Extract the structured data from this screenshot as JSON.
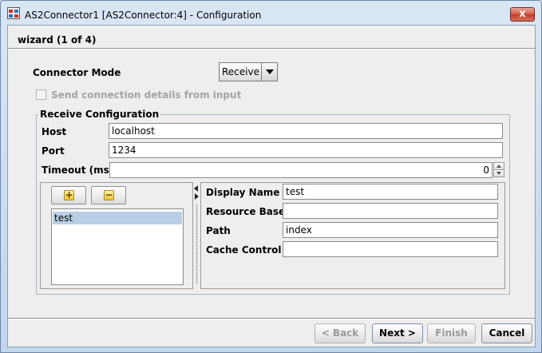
{
  "window": {
    "title": "AS2Connector1 [AS2Connector:4] - Configuration",
    "close_glyph": "x"
  },
  "wizard": {
    "step_title": "wizard (1 of 4)"
  },
  "connector_mode": {
    "label": "Connector Mode",
    "value": "Receive"
  },
  "send_details": {
    "label": "Send connection details from input",
    "checked": false,
    "enabled": false
  },
  "receive_config": {
    "title": "Receive Configuration",
    "host": {
      "label": "Host",
      "value": "localhost"
    },
    "port": {
      "label": "Port",
      "value": "1234"
    },
    "timeout": {
      "label": "Timeout (ms)",
      "value": "0"
    }
  },
  "resources": {
    "add_glyph": "+",
    "remove_glyph": "−",
    "items": [
      "test"
    ],
    "selected": "test"
  },
  "resource_details": {
    "display_name": {
      "label": "Display Name",
      "value": "test"
    },
    "resource_base": {
      "label": "Resource Base",
      "value": ""
    },
    "path": {
      "label": "Path",
      "value": "index"
    },
    "cache_control": {
      "label": "Cache Control",
      "value": ""
    }
  },
  "buttons": {
    "back": "< Back",
    "next": "Next >",
    "finish": "Finish",
    "cancel": "Cancel"
  },
  "icons": {
    "app": "as2-connector-app-icon",
    "add": "plus-icon",
    "remove": "minus-icon",
    "collapse": "arrow-left-icon",
    "expand": "arrow-right-icon"
  }
}
